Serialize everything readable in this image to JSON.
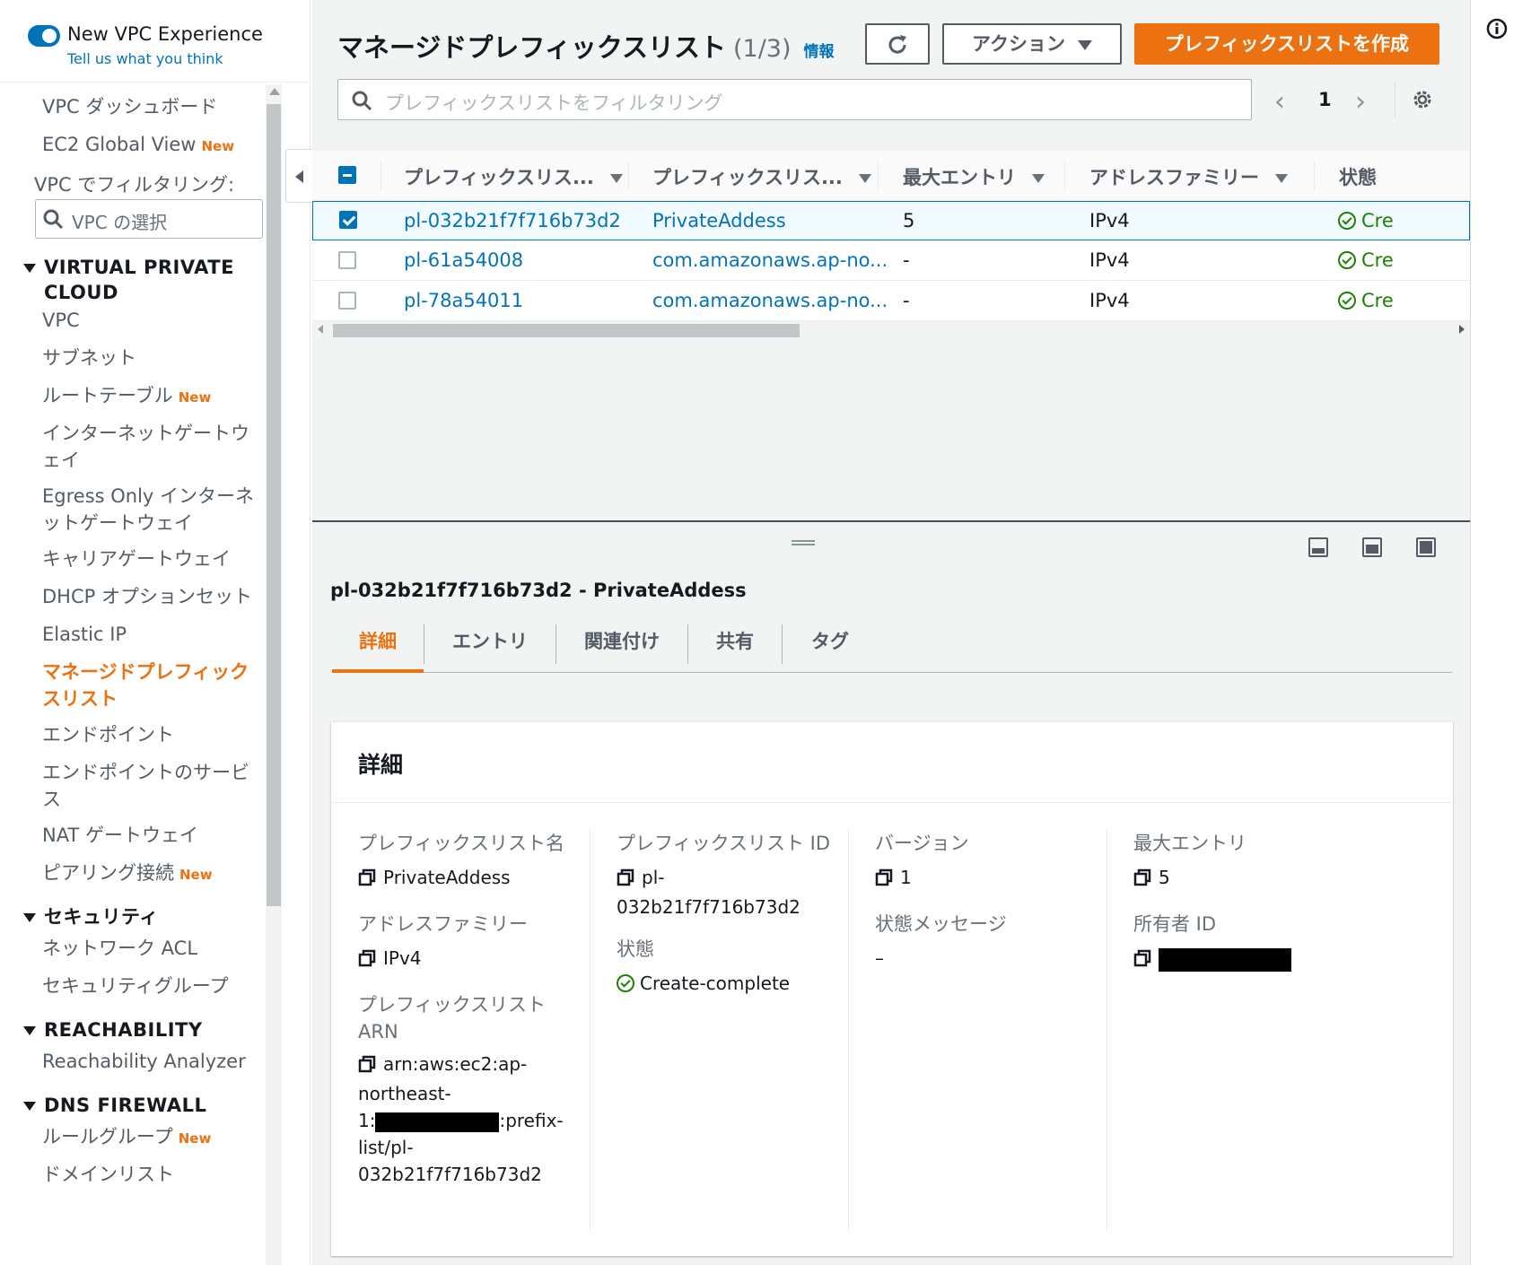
{
  "sidebar": {
    "toggle_label": "New VPC Experience",
    "feedback_link": "Tell us what you think",
    "filter_label": "VPC でフィルタリング:",
    "filter_placeholder": "VPC の選択",
    "new_badge": "New",
    "items": {
      "dashboard": "VPC ダッシュボード",
      "ec2_global_view": "EC2 Global View",
      "vpc": "VPC",
      "subnets": "サブネット",
      "route_tables": "ルートテーブル",
      "igw": "インターネットゲートウェイ",
      "egress_igw": "Egress Only インターネットゲートウェイ",
      "carrier_gw": "キャリアゲートウェイ",
      "dhcp": "DHCP オプションセット",
      "elastic_ip": "Elastic IP",
      "prefix_lists": "マネージドプレフィックスリスト",
      "endpoints": "エンドポイント",
      "endpoint_services": "エンドポイントのサービス",
      "nat": "NAT ゲートウェイ",
      "peering": "ピアリング接続",
      "nacl": "ネットワーク ACL",
      "security_groups": "セキュリティグループ",
      "reachability_analyzer": "Reachability Analyzer",
      "rule_groups": "ルールグループ",
      "domain_lists": "ドメインリスト"
    },
    "sections": {
      "vpc": "VIRTUAL PRIVATE CLOUD",
      "security": "セキュリティ",
      "reachability": "REACHABILITY",
      "dns_firewall": "DNS FIREWALL"
    }
  },
  "header": {
    "title": "マネージドプレフィックスリスト",
    "count": "(1/3)",
    "info": "情報",
    "actions_label": "アクション",
    "create_label": "プレフィックスリストを作成",
    "search_placeholder": "プレフィックスリストをフィルタリング",
    "page": "1"
  },
  "table": {
    "columns": [
      "プレフィックスリス...",
      "プレフィックスリス...",
      "最大エントリ",
      "アドレスファミリー",
      "状態"
    ],
    "rows": [
      {
        "id": "pl-032b21f7f716b73d2",
        "name": "PrivateAddess",
        "max": "5",
        "family": "IPv4",
        "state": "Cre",
        "selected": true
      },
      {
        "id": "pl-61a54008",
        "name": "com.amazonaws.ap-no...",
        "max": "-",
        "family": "IPv4",
        "state": "Cre",
        "selected": false
      },
      {
        "id": "pl-78a54011",
        "name": "com.amazonaws.ap-no...",
        "max": "-",
        "family": "IPv4",
        "state": "Cre",
        "selected": false
      }
    ]
  },
  "split": {
    "title": "pl-032b21f7f716b73d2 - PrivateAddess",
    "tabs": [
      "詳細",
      "エントリ",
      "関連付け",
      "共有",
      "タグ"
    ],
    "card_title": "詳細",
    "fields": {
      "name_label": "プレフィックスリスト名",
      "name_value": "PrivateAddess",
      "family_label": "アドレスファミリー",
      "family_value": "IPv4",
      "arn_label_1": "プレフィックスリスト",
      "arn_label_2": "ARN",
      "arn_line1": "arn:aws:ec2:ap-",
      "arn_line2": "northeast-",
      "arn_line3_prefix": "1:",
      "arn_line3_suffix": ":prefix-",
      "arn_line4": "list/pl-",
      "arn_line5": "032b21f7f716b73d2",
      "id_label": "プレフィックスリスト ID",
      "id_value_1": "pl-",
      "id_value_2": "032b21f7f716b73d2",
      "state_label": "状態",
      "state_value": "Create-complete",
      "version_label": "バージョン",
      "version_value": "1",
      "state_msg_label": "状態メッセージ",
      "state_msg_value": "–",
      "max_label": "最大エントリ",
      "max_value": "5",
      "owner_label": "所有者 ID"
    }
  },
  "colors": {
    "accent": "#ec7211",
    "link": "#0073bb",
    "success": "#1d8102"
  }
}
